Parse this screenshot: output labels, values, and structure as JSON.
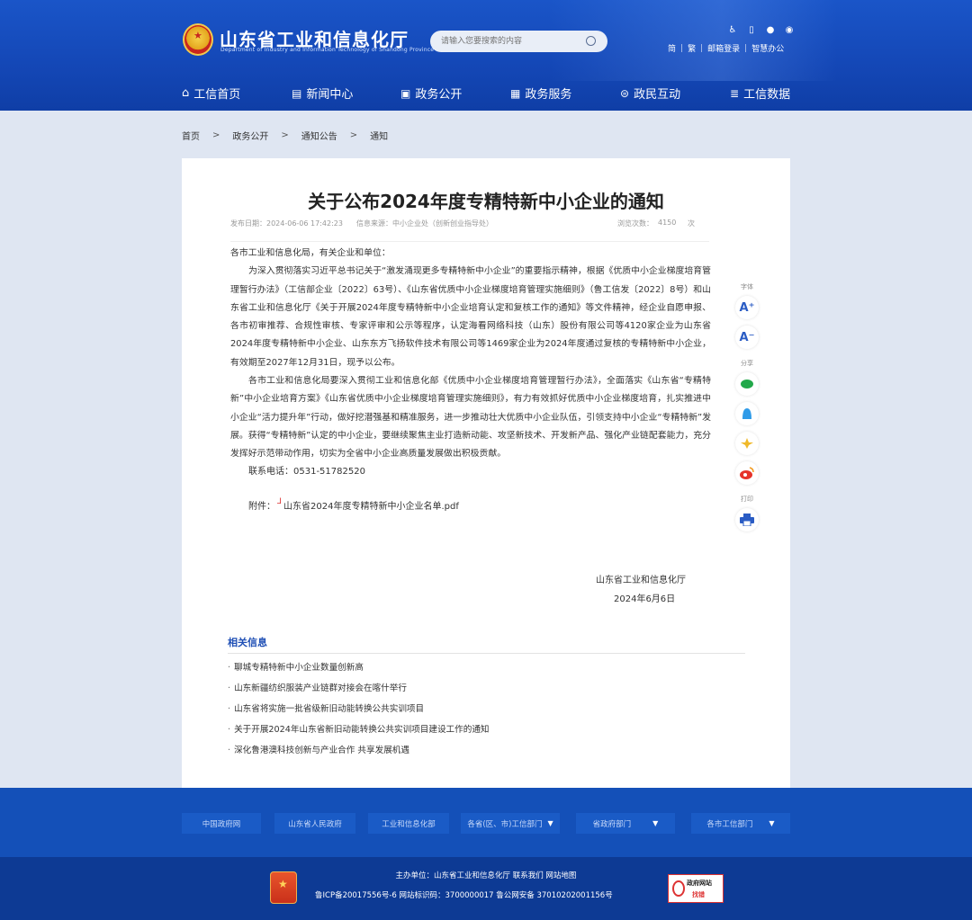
{
  "header": {
    "site_title": "山东省工业和信息化厅",
    "site_subtitle": "Department of Industry and Information Technology of Shandong Province",
    "search_placeholder": "请输入您要搜索的内容",
    "tool_icons": [
      "accessibility-icon",
      "mobile-icon",
      "wechat-icon",
      "weibo-icon"
    ],
    "tool_links": [
      "简",
      "繁",
      "邮箱登录",
      "智慧办公"
    ],
    "nav": [
      {
        "label": "工信首页",
        "icon": "home-icon"
      },
      {
        "label": "新闻中心",
        "icon": "news-icon"
      },
      {
        "label": "政务公开",
        "icon": "public-affairs-icon"
      },
      {
        "label": "政务服务",
        "icon": "service-icon"
      },
      {
        "label": "政民互动",
        "icon": "interaction-icon"
      },
      {
        "label": "工信数据",
        "icon": "database-icon"
      }
    ]
  },
  "breadcrumb": [
    "首页",
    "政务公开",
    "通知公告",
    "通知"
  ],
  "breadcrumb_sep": ">",
  "article": {
    "title": "关于公布2024年度专精特新中小企业的通知",
    "publish_date": "发布日期：2024-06-06 17:42:23",
    "source": "信息来源：中小企业处（创新创业指导处）",
    "views_label": "浏览次数：",
    "views": "4150",
    "views_unit": "次",
    "salutation": "各市工业和信息化局，有关企业和单位：",
    "para1": "为深入贯彻落实习近平总书记关于“激发涌现更多专精特新中小企业”的重要指示精神，根据《优质中小企业梯度培育管理暂行办法》（工信部企业〔2022〕63号）、《山东省优质中小企业梯度培育管理实施细则》（鲁工信发〔2022〕8号）和山东省工业和信息化厅《关于开展2024年度专精特新中小企业培育认定和复核工作的通知》等文件精神，经企业自愿申报、各市初审推荐、合规性审核、专家评审和公示等程序，认定海看网络科技（山东）股份有限公司等4120家企业为山东省2024年度专精特新中小企业、山东东方飞扬软件技术有限公司等1469家企业为2024年度通过复核的专精特新中小企业，有效期至2027年12月31日，现予以公布。",
    "para2": "各市工业和信息化局要深入贯彻工业和信息化部《优质中小企业梯度培育管理暂行办法》，全面落实《山东省“专精特新”中小企业培育方案》《山东省优质中小企业梯度培育管理实施细则》，有力有效抓好优质中小企业梯度培育，扎实推进中小企业“活力提升年”行动，做好挖潜强基和精准服务，进一步推动壮大优质中小企业队伍，引领支持中小企业“专精特新”发展。获得“专精特新”认定的中小企业，要继续聚焦主业打造新动能、攻坚新技术、开发新产品、强化产业链配套能力，充分发挥好示范带动作用，切实为全省中小企业高质量发展做出积极贡献。",
    "contact": "联系电话：0531-51782520",
    "attachment_label": "附件：",
    "attachment_name": "山东省2024年度专精特新中小企业名单.pdf",
    "signature": "山东省工业和信息化厅",
    "sign_date": "2024年6月6日"
  },
  "related": {
    "title": "相关信息",
    "items": [
      "聊城专精特新中小企业数量创新高",
      "山东新疆纺织服装产业链群对接会在喀什举行",
      "山东省将实施一批省级新旧动能转换公共实训项目",
      "关于开展2024年山东省新旧动能转换公共实训项目建设工作的通知",
      "深化鲁港澳科技创新与产业合作 共享发展机遇"
    ]
  },
  "side_tools": {
    "font_label": "字体",
    "share_label": "分享",
    "print_label": "打印"
  },
  "footer": {
    "links": [
      "中国政府网",
      "山东省人民政府",
      "工业和信息化部",
      "各省(区、市)工信部门",
      "省政府部门",
      "各市工信部门"
    ],
    "host": "主办单位：山东省工业和信息化厅 联系我们 网站地图",
    "icp": "鲁ICP备20017556号-6 网站标识码：3700000017 鲁公网安备 37010202001156号",
    "badge_line1": "政府网站",
    "badge_line2": "找错"
  },
  "colors": {
    "header_blue": "#1a55c8",
    "footer_blue": "#1450b8",
    "footer_dark": "#0d3a94",
    "related_title": "#1f4fb5"
  }
}
